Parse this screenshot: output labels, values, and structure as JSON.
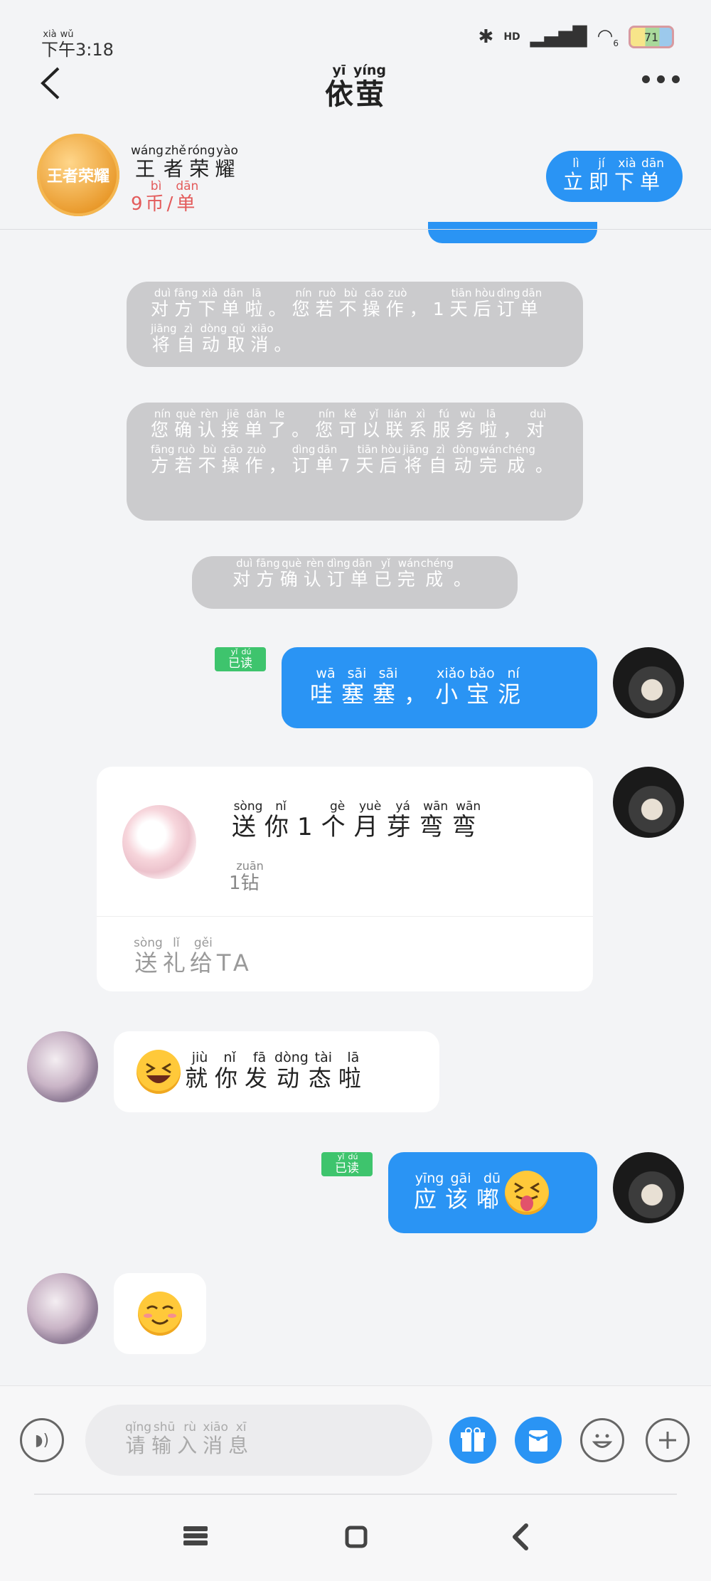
{
  "status_bar": {
    "time_prefix_hanzi": [
      "下",
      "午"
    ],
    "time_prefix_pinyin": [
      "xià",
      "wǔ"
    ],
    "time": "3:18",
    "network_label": "HD",
    "battery": "71",
    "wifi_sub": "6"
  },
  "header": {
    "title_hanzi": [
      "依",
      "萤"
    ],
    "title_pinyin": [
      "yī",
      "yíng"
    ]
  },
  "game_card": {
    "logo_text": "王者荣耀",
    "name_hanzi": [
      "王",
      "者",
      "荣",
      "耀"
    ],
    "name_pinyin": [
      "wáng",
      "zhě",
      "róng",
      "yào"
    ],
    "price_num": "9",
    "price_hanzi": [
      "币",
      "/",
      "单"
    ],
    "price_pinyin": [
      "bì",
      "",
      "dān"
    ],
    "order_button_hanzi": [
      "立",
      "即",
      "下",
      "单"
    ],
    "order_button_pinyin": [
      "lì",
      "jí",
      "xià",
      "dān"
    ]
  },
  "system_notes": [
    {
      "hanzi": [
        "对",
        "方",
        "下",
        "单",
        "啦",
        "。",
        "您",
        "若",
        "不",
        "操",
        "作",
        "，",
        "1",
        "天",
        "后",
        "订",
        "单",
        "将",
        "自",
        "动",
        "取",
        "消",
        "。"
      ],
      "pinyin": [
        "duì",
        "fāng",
        "xià",
        "dān",
        "lā",
        "",
        "nín",
        "ruò",
        "bù",
        "cāo",
        "zuò",
        "",
        "",
        "tiān",
        "hòu",
        "dìng",
        "dān",
        "jiāng",
        "zì",
        "dòng",
        "qǔ",
        "xiāo",
        ""
      ]
    },
    {
      "hanzi": [
        "您",
        "确",
        "认",
        "接",
        "单",
        "了",
        "。",
        "您",
        "可",
        "以",
        "联",
        "系",
        "服",
        "务",
        "啦",
        "，",
        "对",
        "方",
        "若",
        "不",
        "操",
        "作",
        "，",
        "订",
        "单",
        "7",
        "天",
        "后",
        "将",
        "自",
        "动",
        "完",
        "成",
        "。"
      ],
      "pinyin": [
        "nín",
        "què",
        "rèn",
        "jiē",
        "dān",
        "le",
        "",
        "nín",
        "kě",
        "yǐ",
        "lián",
        "xì",
        "fú",
        "wù",
        "lā",
        "",
        "duì",
        "fāng",
        "ruò",
        "bù",
        "cāo",
        "zuò",
        "",
        "dìng",
        "dān",
        "",
        "tiān",
        "hòu",
        "jiāng",
        "zì",
        "dòng",
        "wán",
        "chéng",
        ""
      ]
    },
    {
      "hanzi": [
        "对",
        "方",
        "确",
        "认",
        "订",
        "单",
        "已",
        "完",
        "成",
        "。"
      ],
      "pinyin": [
        "duì",
        "fāng",
        "què",
        "rèn",
        "dìng",
        "dān",
        "yǐ",
        "wán",
        "chéng",
        ""
      ]
    }
  ],
  "read_label_hanzi": [
    "已",
    "读"
  ],
  "read_label_pinyin": [
    "yǐ",
    "dú"
  ],
  "messages": {
    "msg1_hanzi": [
      "哇",
      "塞",
      "塞",
      "，",
      "小",
      "宝",
      "泥"
    ],
    "msg1_pinyin": [
      "wā",
      "sāi",
      "sāi",
      "",
      "xiǎo",
      "bǎo",
      "ní"
    ],
    "gift_title_hanzi": [
      "送",
      "你",
      "1",
      "个",
      "月",
      "芽",
      "弯",
      "弯"
    ],
    "gift_title_pinyin": [
      "sòng",
      "nǐ",
      "",
      "gè",
      "yuè",
      "yá",
      "wān",
      "wān"
    ],
    "gift_price_num": "1",
    "gift_price_hanzi": "钻",
    "gift_price_pinyin": "zuān",
    "gift_send_hanzi": [
      "送",
      "礼",
      "给"
    ],
    "gift_send_pinyin": [
      "sòng",
      "lǐ",
      "gěi"
    ],
    "gift_send_suffix": "TA",
    "msg3_hanzi": [
      "就",
      "你",
      "发",
      "动",
      "态",
      "啦"
    ],
    "msg3_pinyin": [
      "jiù",
      "nǐ",
      "fā",
      "dòng",
      "tài",
      "lā"
    ],
    "msg4_hanzi": [
      "应",
      "该",
      "嘟"
    ],
    "msg4_pinyin": [
      "yīng",
      "gāi",
      "dū"
    ]
  },
  "input": {
    "placeholder_hanzi": [
      "请",
      "输",
      "入",
      "消",
      "息"
    ],
    "placeholder_pinyin": [
      "qǐng",
      "shū",
      "rù",
      "xiāo",
      "xī"
    ]
  },
  "colors": {
    "accent": "#2a94f4",
    "read_badge": "#3ec46d",
    "price_red": "#e35b5b",
    "system_note": "#cbcbcd"
  }
}
